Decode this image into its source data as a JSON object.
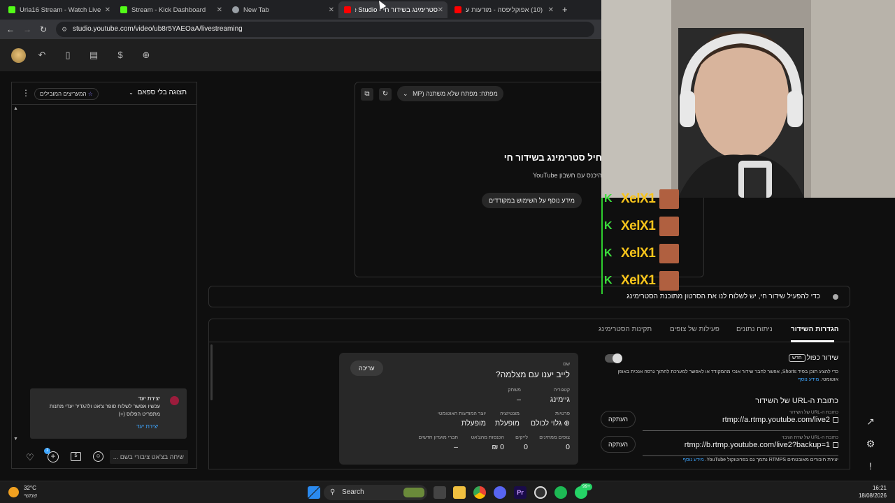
{
  "browser": {
    "tabs": [
      {
        "title": "Uria16 Stream - Watch Live on",
        "icon_color": "#53fc18"
      },
      {
        "title": "Stream - Kick Dashboard",
        "icon_color": "#53fc18"
      },
      {
        "title": "New Tab",
        "icon_color": "#9aa0a6"
      },
      {
        "title": "סטרימינג בשידור חי - be Studio",
        "icon_color": "#ff0000"
      },
      {
        "title": "(10) אפוקליפסה - מודעות ע",
        "icon_color": "#ff0000"
      }
    ],
    "new_tab": "+",
    "url": "studio.youtube.com/video/ub8r5YAEOaA/livestreaming"
  },
  "chat": {
    "view_mode": "תצוגה בלי ספאם",
    "top_chatters": "המעריצים המובילים",
    "goal_card": {
      "title": "יצירת יעד",
      "text": "עכשיו אפשר לשלוח סופר צ'אט ולהגדיר יעדי מתנות מתפריט הפלוס (+)",
      "action": "יצירת יעד"
    },
    "input_placeholder": "שיחה בצ'אט ציבורי בשם ...",
    "badge_count": "1"
  },
  "preview": {
    "stream_key": "מפתח: מפתח שלא משתנה (MP",
    "heading": "חבר את המקודד כדי להתחיל סטרימינג בשידור חי",
    "subtext": "העתק והדבק מפתח שידור במקודד או להיכנס עם חשבון YouTube",
    "more_info": "מידע נוסף על השימוש במקודדים"
  },
  "status_message": "כדי להפעיל שידור חי, יש לשלוח לנו את הסרטון מתוכנת הסטרימינג",
  "settings": {
    "tabs": [
      "הגדרות השידור",
      "ניתוח נתונים",
      "פעילות של צופים",
      "תקינות הסטרימינג"
    ],
    "dual_stream": {
      "label": "שידור כפול",
      "badge": "חדש",
      "description": "כדי להציג תוכן בפיד Shorts, אפשר לחבר שידור אנכי מהמקודד או לאפשר למערכת לחתוך גרסה אנכית באופן אוטומטי.",
      "link": "מידע נוסף"
    },
    "url_title": "כתובת ה-URL של השידור",
    "primary_label": "כתובת ה-URL של השידור",
    "primary_url": "rtmp://a.rtmp.youtube.com/live2",
    "backup_label": "כתובת ה-URL של שרת הגיבוי",
    "backup_url": "rtmp://b.rtmp.youtube.com/live2?backup=1",
    "copy_label": "העתקה",
    "rtmps_note": "יצירת חיבורים מאובטחים RTMPS נתמך גם בפרוטוקול YouTube.",
    "rtmps_link": "מידע נוסף"
  },
  "details": {
    "edit": "עריכה",
    "name_label": "שם",
    "name_value": "לייב יענו עם מצלמה?",
    "category_label": "קטגוריה",
    "category_value": "גיימינג",
    "game_label": "משחק",
    "game_value": "–",
    "privacy_label": "פרטיות",
    "privacy_value": "גלוי לכולם",
    "monetization_label": "מונטיזציה",
    "monetization_value": "מופעלת",
    "auto_ads_label": "יוצר המודעות האוטומטי",
    "auto_ads_value": "מופעלת",
    "waiting_label": "צופים ממתינים",
    "waiting_value": "0",
    "likes_label": "לייקים",
    "likes_value": "0",
    "revenue_label": "הכנסות מהצ'אט",
    "revenue_value": "0 ₪",
    "members_label": "חברי מועדון חדשים",
    "members_value": "–"
  },
  "overlay": {
    "name": "XelX1",
    "rows": 4
  },
  "taskbar": {
    "weather_temp": "32°C",
    "weather_desc": "שמשי",
    "search": "Search",
    "time": "16:21",
    "date": "18/08/2026",
    "notif_badge": "99+"
  }
}
